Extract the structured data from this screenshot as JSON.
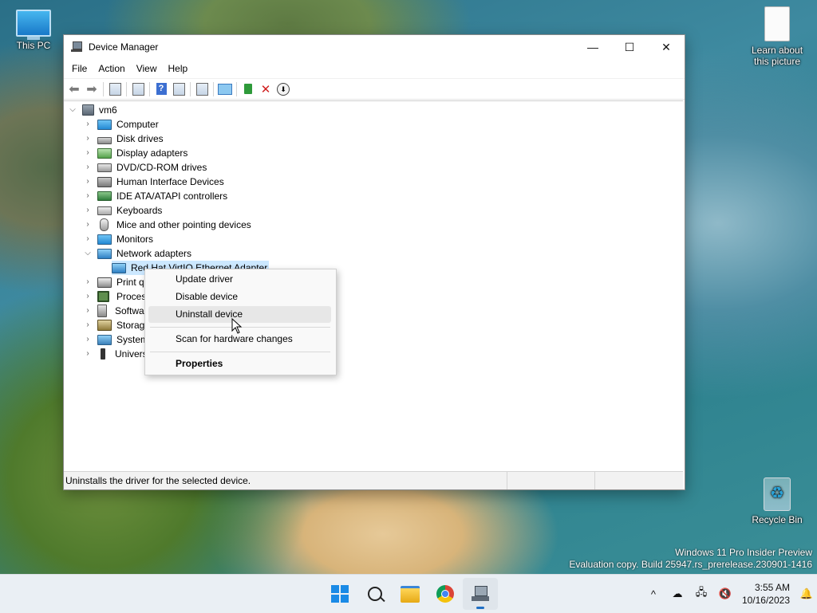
{
  "desktop": {
    "icons": [
      {
        "label": "This PC"
      },
      {
        "label": "Learn about this picture"
      },
      {
        "label": "Recycle Bin"
      }
    ],
    "watermark": {
      "line1": "Windows 11 Pro Insider Preview",
      "line2": "Evaluation copy. Build 25947.rs_prerelease.230901-1416"
    }
  },
  "window": {
    "title": "Device Manager",
    "caption": {
      "minimize": "—",
      "maximize": "☐",
      "close": "✕"
    },
    "menu": [
      "File",
      "Action",
      "View",
      "Help"
    ],
    "tree": {
      "root": "vm6",
      "items": [
        {
          "label": "Computer",
          "icon": "monitor-icon",
          "expanded": false
        },
        {
          "label": "Disk drives",
          "icon": "disk-drive-icon",
          "expanded": false
        },
        {
          "label": "Display adapters",
          "icon": "display-adapter-icon",
          "expanded": false
        },
        {
          "label": "DVD/CD-ROM drives",
          "icon": "dvd-drive-icon",
          "expanded": false
        },
        {
          "label": "Human Interface Devices",
          "icon": "hid-icon",
          "expanded": false
        },
        {
          "label": "IDE ATA/ATAPI controllers",
          "icon": "ide-controller-icon",
          "expanded": false
        },
        {
          "label": "Keyboards",
          "icon": "keyboard-icon",
          "expanded": false
        },
        {
          "label": "Mice and other pointing devices",
          "icon": "mouse-icon",
          "expanded": false
        },
        {
          "label": "Monitors",
          "icon": "monitor-icon",
          "expanded": false
        },
        {
          "label": "Network adapters",
          "icon": "network-adapter-icon",
          "expanded": true
        },
        {
          "label": "Red Hat VirtIO Ethernet Adapter",
          "icon": "network-adapter-icon",
          "child": true,
          "selected": true
        },
        {
          "label": "Print qu",
          "icon": "printer-icon",
          "expanded": false
        },
        {
          "label": "Process",
          "icon": "processor-icon",
          "expanded": false
        },
        {
          "label": "Softwar",
          "icon": "software-device-icon",
          "expanded": false
        },
        {
          "label": "Storage",
          "icon": "storage-controller-icon",
          "expanded": false
        },
        {
          "label": "System",
          "icon": "system-devices-icon",
          "expanded": false
        },
        {
          "label": "Univers",
          "icon": "usb-icon",
          "expanded": false
        }
      ]
    },
    "status_text": "Uninstalls the driver for the selected device."
  },
  "context_menu": {
    "items": [
      {
        "label": "Update driver"
      },
      {
        "label": "Disable device"
      },
      {
        "label": "Uninstall device",
        "hover": true
      },
      {
        "label": "Scan for hardware changes"
      },
      {
        "label": "Properties",
        "bold": true
      }
    ]
  },
  "taskbar": {
    "apps": [
      "start-icon",
      "search-icon",
      "file-explorer-icon",
      "chrome-icon",
      "device-manager-icon"
    ],
    "active_app": "device-manager-icon",
    "tray": {
      "chevron": "^",
      "time": "3:55 AM",
      "date": "10/16/2023"
    }
  },
  "colors": {
    "selection": "#cce8ff",
    "menu_hover": "#e7e7e7",
    "accent": "#1f6fc4"
  }
}
